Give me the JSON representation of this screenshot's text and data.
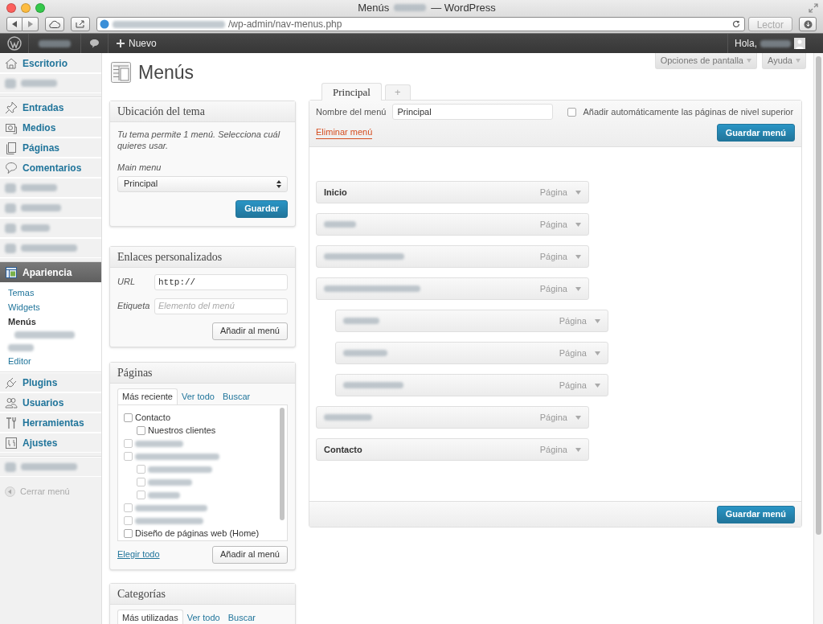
{
  "browser": {
    "title": "Menús",
    "title_suffix": "— WordPress",
    "url_path": "/wp-admin/nav-menus.php",
    "reader_button": "Lector"
  },
  "admin_bar": {
    "new_label": "Nuevo",
    "greeting": "Hola,"
  },
  "sidebar": {
    "items": [
      {
        "kind": "item",
        "label": "Escritorio",
        "selected": false
      },
      {
        "kind": "blurred"
      },
      {
        "kind": "separator"
      },
      {
        "kind": "item",
        "label": "Entradas",
        "selected": false
      },
      {
        "kind": "item",
        "label": "Medios",
        "selected": false
      },
      {
        "kind": "item",
        "label": "Páginas",
        "selected": false
      },
      {
        "kind": "item",
        "label": "Comentarios",
        "selected": false
      },
      {
        "kind": "blurred"
      },
      {
        "kind": "blurred"
      },
      {
        "kind": "blurred"
      },
      {
        "kind": "blurred"
      },
      {
        "kind": "separator"
      },
      {
        "kind": "item",
        "label": "Apariencia",
        "selected": true,
        "submenu": [
          {
            "kind": "item",
            "label": "Temas",
            "selected": false
          },
          {
            "kind": "item",
            "label": "Widgets",
            "selected": false
          },
          {
            "kind": "item",
            "label": "Menús",
            "selected": true
          },
          {
            "kind": "blurred2"
          },
          {
            "kind": "item",
            "label": "Editor",
            "selected": false
          }
        ]
      },
      {
        "kind": "item",
        "label": "Plugins",
        "selected": false
      },
      {
        "kind": "item",
        "label": "Usuarios",
        "selected": false
      },
      {
        "kind": "item",
        "label": "Herramientas",
        "selected": false
      },
      {
        "kind": "item",
        "label": "Ajustes",
        "selected": false
      },
      {
        "kind": "separator"
      },
      {
        "kind": "blurred"
      }
    ],
    "collapse_label": "Cerrar menú"
  },
  "screen_buttons": [
    "Opciones de pantalla",
    "Ayuda"
  ],
  "page_title": "Menús",
  "theme_location": {
    "title": "Ubicación del tema",
    "description": "Tu tema permite 1 menú. Selecciona cuál quieres usar.",
    "select_label": "Main menu",
    "select_value": "Principal",
    "button": "Guardar"
  },
  "custom_links": {
    "title": "Enlaces personalizados",
    "fields": [
      {
        "label": "URL",
        "value": "http://"
      },
      {
        "label": "Etiqueta",
        "placeholder": "Elemento del menú"
      }
    ],
    "button": "Añadir al menú"
  },
  "pages": {
    "title": "Páginas",
    "tabs": [
      {
        "label": "Más reciente",
        "selected": true
      },
      {
        "label": "Ver todo",
        "selected": false
      },
      {
        "label": "Buscar",
        "selected": false
      }
    ],
    "items": [
      {
        "kind": "page",
        "label": "Contacto",
        "checked": false,
        "children": [
          {
            "kind": "page",
            "label": "Nuestros clientes",
            "checked": false
          }
        ]
      },
      {
        "kind": "blurred",
        "checked": false
      },
      {
        "kind": "blurred",
        "checked": false,
        "children": [
          {
            "kind": "blurred",
            "checked": false
          },
          {
            "kind": "blurred",
            "checked": false
          },
          {
            "kind": "blurred",
            "checked": false
          }
        ]
      },
      {
        "kind": "blurred",
        "checked": false
      },
      {
        "kind": "blurred",
        "checked": false
      },
      {
        "kind": "page",
        "label": "Diseño de páginas web (Home)",
        "checked": false
      }
    ],
    "select_all": "Elegir todo",
    "button": "Añadir al menú"
  },
  "categories": {
    "title": "Categorías",
    "tabs": [
      {
        "label": "Más utilizadas",
        "selected": true
      },
      {
        "label": "Ver todo",
        "selected": false
      },
      {
        "label": "Buscar",
        "selected": false
      }
    ]
  },
  "menu_tabs": [
    {
      "label": "Principal",
      "selected": true
    },
    {
      "label": "+",
      "selected": false
    }
  ],
  "menu_editor": {
    "name_label": "Nombre del menú",
    "name_value": "Principal",
    "auto_add": {
      "label": "Añadir automáticamente las páginas de nivel superior",
      "checked": false
    },
    "delete_link": "Eliminar menú",
    "save_button": "Guardar menú",
    "items": [
      {
        "kind": "page",
        "title": "Inicio",
        "type": "Página"
      },
      {
        "kind": "blurred",
        "type": "Página"
      },
      {
        "kind": "blurred",
        "type": "Página"
      },
      {
        "kind": "blurred",
        "type": "Página",
        "children": [
          {
            "kind": "blurred",
            "type": "Página"
          },
          {
            "kind": "blurred",
            "type": "Página"
          },
          {
            "kind": "blurred",
            "type": "Página"
          }
        ]
      },
      {
        "kind": "blurred",
        "type": "Página"
      },
      {
        "kind": "page",
        "title": "Contacto",
        "type": "Página"
      }
    ],
    "footer_button": "Guardar menú"
  }
}
